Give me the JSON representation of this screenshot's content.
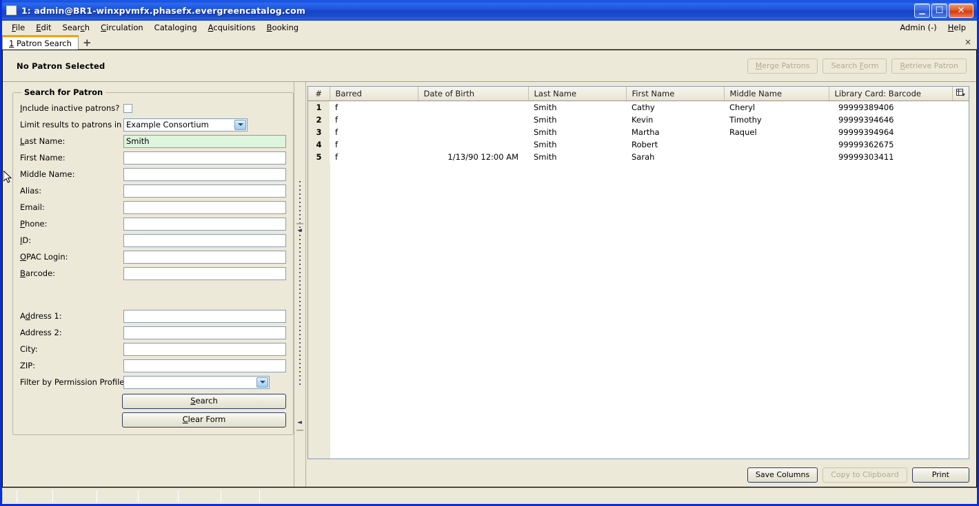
{
  "window": {
    "title": "1: admin@BR1-winxpvmfx.phasefx.evergreencatalog.com",
    "minimize_glyph": "_",
    "maximize_glyph": "☐",
    "close_glyph": "✕"
  },
  "menubar": {
    "items": [
      {
        "label": "File",
        "accel": "F"
      },
      {
        "label": "Edit",
        "accel": "E"
      },
      {
        "label": "Search",
        "accel": "c"
      },
      {
        "label": "Circulation",
        "accel": "C"
      },
      {
        "label": "Cataloging",
        "accel": "g"
      },
      {
        "label": "Acquisitions",
        "accel": "A"
      },
      {
        "label": "Booking",
        "accel": "B"
      }
    ],
    "admin_label": "Admin (-)",
    "help_label": "Help"
  },
  "tabs": {
    "items": [
      {
        "number": "1",
        "label": "Patron Search"
      }
    ],
    "new_tab_glyph": "+",
    "close_glyph": "×"
  },
  "patron_bar": {
    "status": "No Patron Selected",
    "buttons": [
      {
        "label": "Merge Patrons",
        "enabled": false
      },
      {
        "label": "Search Form",
        "enabled": false
      },
      {
        "label": "Retrieve Patron",
        "enabled": false
      }
    ]
  },
  "search_form": {
    "legend": "Search for Patron",
    "include_inactive_label": "Include inactive patrons?",
    "include_inactive_checked": false,
    "limit_results_label": "Limit results to patrons in",
    "limit_results_value": "Example Consortium",
    "fields": [
      {
        "label": "Last Name:",
        "value": "Smith",
        "filled": true
      },
      {
        "label": "First Name:",
        "value": "",
        "filled": false
      },
      {
        "label": "Middle Name:",
        "value": "",
        "filled": false
      },
      {
        "label": "Alias:",
        "value": "",
        "filled": false
      },
      {
        "label": "Email:",
        "value": "",
        "filled": false
      },
      {
        "label": "Phone:",
        "value": "",
        "filled": false
      },
      {
        "label": "ID:",
        "value": "",
        "filled": false
      },
      {
        "label": "OPAC Login:",
        "value": "",
        "filled": false
      },
      {
        "label": "Barcode:",
        "value": "",
        "filled": false
      }
    ],
    "address_fields": [
      {
        "label": "Address 1:",
        "value": ""
      },
      {
        "label": "Address 2:",
        "value": ""
      },
      {
        "label": "City:",
        "value": ""
      },
      {
        "label": "ZIP:",
        "value": ""
      }
    ],
    "permission_profile_label": "Filter by Permission Profile:",
    "permission_profile_value": "",
    "search_button": "Search",
    "clear_button": "Clear Form"
  },
  "results": {
    "columns": [
      "#",
      "Barred",
      "Date of Birth",
      "Last Name",
      "First Name",
      "Middle Name",
      "Library Card: Barcode"
    ],
    "column_picker_icon": "column-picker-icon",
    "rows": [
      {
        "num": "1",
        "barred": "f",
        "dob": "",
        "last": "Smith",
        "first": "Cathy",
        "middle": "Cheryl",
        "barcode": "99999389406"
      },
      {
        "num": "2",
        "barred": "f",
        "dob": "",
        "last": "Smith",
        "first": "Kevin",
        "middle": "Timothy",
        "barcode": "99999394646"
      },
      {
        "num": "3",
        "barred": "f",
        "dob": "",
        "last": "Smith",
        "first": "Martha",
        "middle": "Raquel",
        "barcode": "99999394964"
      },
      {
        "num": "4",
        "barred": "f",
        "dob": "",
        "last": "Smith",
        "first": "Robert",
        "middle": "",
        "barcode": "99999362675"
      },
      {
        "num": "5",
        "barred": "f",
        "dob": "1/13/90 12:00 AM",
        "last": "Smith",
        "first": "Sarah",
        "middle": "",
        "barcode": "99999303411"
      }
    ],
    "buttons": [
      {
        "label": "Save Columns",
        "enabled": true
      },
      {
        "label": "Copy to Clipboard",
        "enabled": false
      },
      {
        "label": "Print",
        "enabled": true
      }
    ]
  },
  "colors": {
    "titlebar_blue": "#1d4fd6",
    "window_border_blue": "#0a2fd6",
    "chrome_beige": "#ece9d8",
    "tab_accent_orange": "#f2a000",
    "filled_field_green": "#ddf4dd",
    "disabled_text": "#b0ab95"
  }
}
